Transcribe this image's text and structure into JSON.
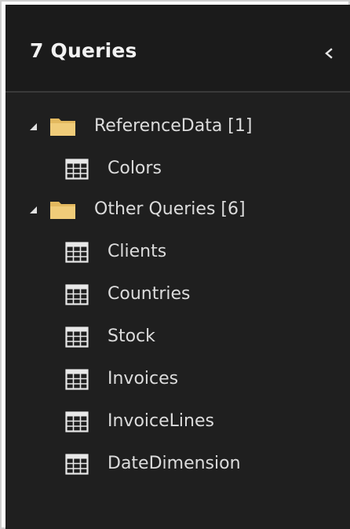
{
  "header": {
    "title": "7 Queries",
    "collapse_icon": "chevron-left-icon"
  },
  "colors": {
    "panel_bg": "#1f1f1f",
    "folder": "#e8c06a",
    "text": "#dcdcdc"
  },
  "tree": {
    "groups": [
      {
        "label": "ReferenceData [1]",
        "expanded": true,
        "items": [
          {
            "label": "Colors",
            "icon": "table-icon"
          }
        ]
      },
      {
        "label": "Other Queries [6]",
        "expanded": true,
        "items": [
          {
            "label": "Clients",
            "icon": "table-icon"
          },
          {
            "label": "Countries",
            "icon": "table-icon"
          },
          {
            "label": "Stock",
            "icon": "table-icon"
          },
          {
            "label": "Invoices",
            "icon": "table-icon"
          },
          {
            "label": "InvoiceLines",
            "icon": "table-icon"
          },
          {
            "label": "DateDimension",
            "icon": "table-icon"
          }
        ]
      }
    ]
  }
}
